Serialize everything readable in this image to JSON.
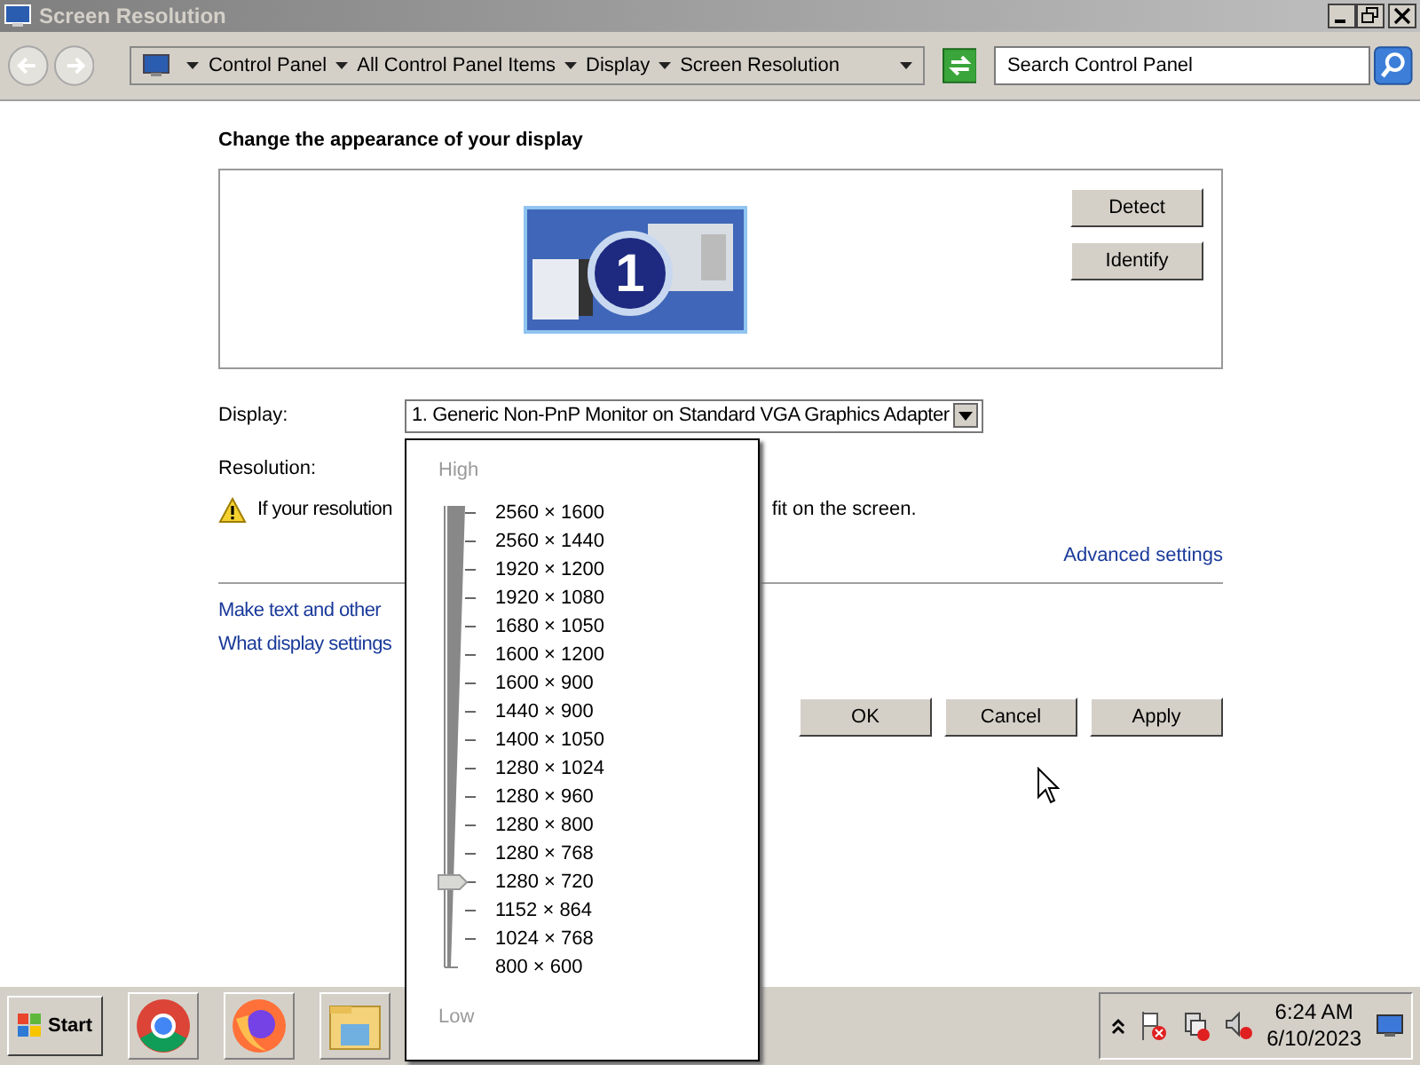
{
  "window": {
    "title": "Screen Resolution"
  },
  "address_bar": {
    "breadcrumbs": [
      "Control Panel",
      "All Control Panel Items",
      "Display",
      "Screen Resolution"
    ]
  },
  "search": {
    "placeholder": "Search Control Panel"
  },
  "heading": "Change the appearance of your display",
  "monitor": {
    "number": "1"
  },
  "side_buttons": [
    "Detect",
    "Identify"
  ],
  "display": {
    "label": "Display:",
    "value": "1. Generic Non-PnP Monitor on Standard VGA Graphics Adapter"
  },
  "resolution": {
    "label": "Resolution:"
  },
  "warning": {
    "before": "If your resolution",
    "after": "fit on the screen."
  },
  "advanced_link": "Advanced settings",
  "links": [
    "Make text and other",
    "What display settings"
  ],
  "dialog_buttons": [
    "OK",
    "Cancel",
    "Apply"
  ],
  "resolution_popup": {
    "high": "High",
    "low": "Low",
    "level": 0.1875,
    "options": [
      "2560 × 1600",
      "2560 × 1440",
      "1920 × 1200",
      "1920 × 1080",
      "1680 × 1050",
      "1600 × 1200",
      "1600 × 900",
      "1440 × 900",
      "1400 × 1050",
      "1280 × 1024",
      "1280 × 960",
      "1280 × 800",
      "1280 × 768",
      "1280 × 720",
      "1152 × 864",
      "1024 × 768",
      "800 × 600"
    ]
  },
  "taskbar": {
    "start": "Start",
    "clock": {
      "time": "6:24 AM",
      "date": "6/10/2023"
    }
  }
}
